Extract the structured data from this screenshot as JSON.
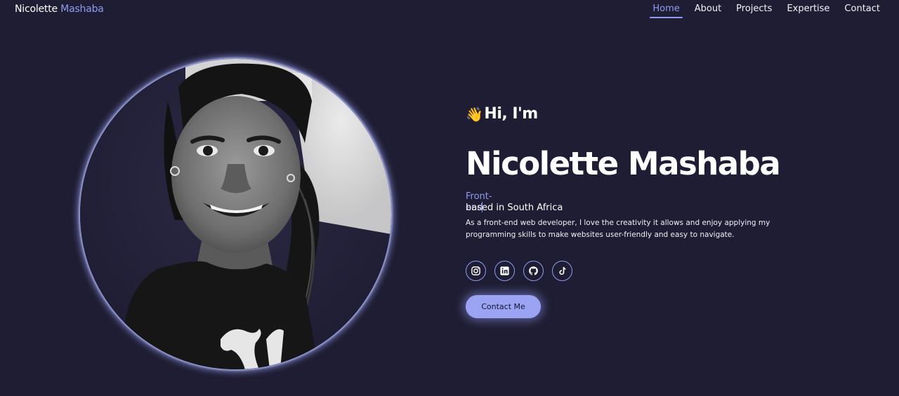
{
  "brand": {
    "first": "Nicolette",
    "last": "Mashaba"
  },
  "nav": [
    {
      "label": "Home",
      "active": true
    },
    {
      "label": "About"
    },
    {
      "label": "Projects"
    },
    {
      "label": "Expertise"
    },
    {
      "label": "Contact"
    }
  ],
  "hero": {
    "wave_icon": "👋",
    "greeting": "Hi, I'm",
    "name": "Nicolette Mashaba",
    "role_typed": "Front-end",
    "location": "based in South Africa",
    "bio": "As a front-end web developer, I love the creativity it allows and enjoy applying my programming skills to make websites user-friendly and easy to navigate.",
    "socials": [
      "instagram-icon",
      "linkedin-icon",
      "github-icon",
      "tiktok-icon"
    ],
    "cta": "Contact Me"
  },
  "portrait": {
    "alt": "profile photo"
  },
  "colors": {
    "background": "#1f1d33",
    "accent": "#8f9cf0",
    "button": "#9aa4f2"
  }
}
